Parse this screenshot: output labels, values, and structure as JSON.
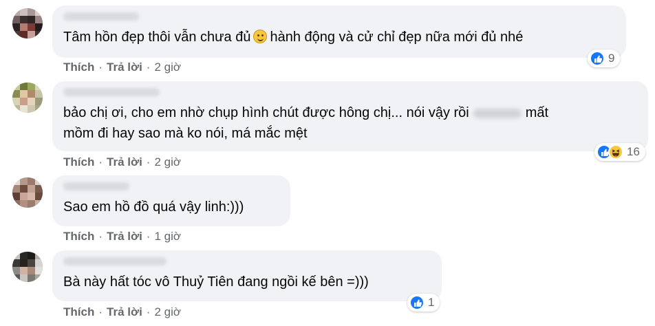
{
  "comments": [
    {
      "text": "Tâm hồn đẹp thôi vẫn chưa đủ",
      "text_after_emoji": "hành động và cử chỉ đẹp nữa mới đủ nhé",
      "emoji_icon": "slightly-smiling-face-icon",
      "reactions": [
        "like"
      ],
      "reaction_count": "9",
      "actions": {
        "like": "Thích",
        "reply": "Trả lời",
        "time": "2 giờ"
      }
    },
    {
      "text_line1_before": "bảo chị ơi, cho em nhờ chụp hình chút được hông chị... nói vậy rồi",
      "text_line1_after": "mất",
      "text_line2": "mồm đi hay sao mà ko nói, má mắc mệt",
      "reactions": [
        "like",
        "haha"
      ],
      "reaction_count": "16",
      "actions": {
        "like": "Thích",
        "reply": "Trả lời",
        "time": "2 giờ"
      }
    },
    {
      "text": "Sao em hồ đồ quá vậy linh:)))",
      "actions": {
        "like": "Thích",
        "reply": "Trả lời",
        "time": "1 giờ"
      }
    },
    {
      "text": "Bà này hất tóc vô Thuỷ Tiên đang ngồi kế bên =)))",
      "reactions": [
        "like"
      ],
      "reaction_count": "1",
      "actions": {
        "like": "Thích",
        "reply": "Trả lời",
        "time": "2 giờ"
      }
    }
  ],
  "colors": {
    "bubble": "#f0f2f5",
    "like_blue": "#1877f2",
    "meta_gray": "#65676b",
    "text": "#050505"
  }
}
